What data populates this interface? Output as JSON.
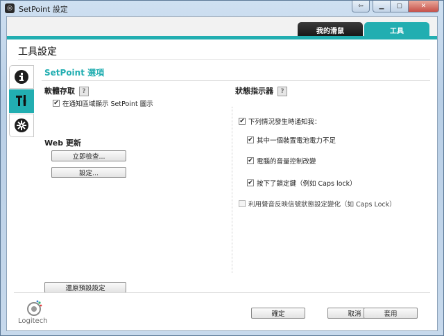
{
  "window": {
    "title": "SetPoint 設定"
  },
  "tabs": [
    {
      "label": "我的滑鼠"
    },
    {
      "label": "工具"
    }
  ],
  "page": {
    "title": "工具設定"
  },
  "side_tabs": [
    {
      "icon": "info-icon"
    },
    {
      "icon": "tools-icon"
    },
    {
      "icon": "gear-icon"
    }
  ],
  "section": {
    "title": "SetPoint 選項"
  },
  "software": {
    "title": "軟體存取",
    "help": "?",
    "tray_checkbox": {
      "label": "在通知區域顯示 SetPoint 圖示",
      "checked": true
    }
  },
  "web_update": {
    "title": "Web 更新",
    "check_now_label": "立即檢查...",
    "settings_label": "設定..."
  },
  "status": {
    "title": "狀態指示器",
    "help": "?",
    "notify_checkbox": {
      "label": "下列情況發生時通知我：",
      "checked": true
    },
    "items": [
      {
        "label": "其中一個裝置電池電力不足",
        "checked": true
      },
      {
        "label": "電腦的音量控制改變",
        "checked": true
      },
      {
        "label": "按下了鎖定鍵（例如 Caps lock）",
        "checked": true
      }
    ],
    "sound_checkbox": {
      "label": "利用聲音反映信號狀態設定變化（如 Caps Lock）",
      "checked": false
    }
  },
  "footer": {
    "restore_label": "還原預設設定",
    "ok_label": "確定",
    "cancel_label": "取消",
    "apply_label": "套用",
    "logo_text": "Logitech"
  },
  "colors": {
    "accent": "#22aeb1",
    "dark_tab": "#1e1e1e"
  }
}
